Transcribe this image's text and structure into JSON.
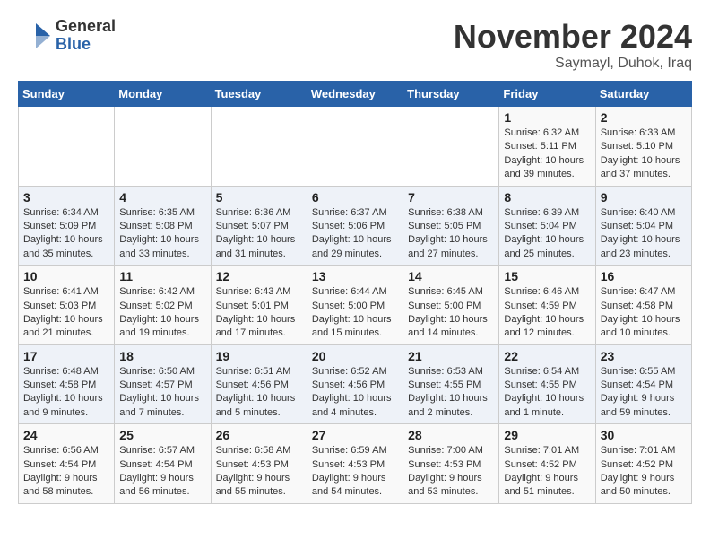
{
  "logo": {
    "general": "General",
    "blue": "Blue"
  },
  "title": "November 2024",
  "subtitle": "Saymayl, Duhok, Iraq",
  "days_of_week": [
    "Sunday",
    "Monday",
    "Tuesday",
    "Wednesday",
    "Thursday",
    "Friday",
    "Saturday"
  ],
  "weeks": [
    [
      {
        "day": "",
        "detail": ""
      },
      {
        "day": "",
        "detail": ""
      },
      {
        "day": "",
        "detail": ""
      },
      {
        "day": "",
        "detail": ""
      },
      {
        "day": "",
        "detail": ""
      },
      {
        "day": "1",
        "detail": "Sunrise: 6:32 AM\nSunset: 5:11 PM\nDaylight: 10 hours\nand 39 minutes."
      },
      {
        "day": "2",
        "detail": "Sunrise: 6:33 AM\nSunset: 5:10 PM\nDaylight: 10 hours\nand 37 minutes."
      }
    ],
    [
      {
        "day": "3",
        "detail": "Sunrise: 6:34 AM\nSunset: 5:09 PM\nDaylight: 10 hours\nand 35 minutes."
      },
      {
        "day": "4",
        "detail": "Sunrise: 6:35 AM\nSunset: 5:08 PM\nDaylight: 10 hours\nand 33 minutes."
      },
      {
        "day": "5",
        "detail": "Sunrise: 6:36 AM\nSunset: 5:07 PM\nDaylight: 10 hours\nand 31 minutes."
      },
      {
        "day": "6",
        "detail": "Sunrise: 6:37 AM\nSunset: 5:06 PM\nDaylight: 10 hours\nand 29 minutes."
      },
      {
        "day": "7",
        "detail": "Sunrise: 6:38 AM\nSunset: 5:05 PM\nDaylight: 10 hours\nand 27 minutes."
      },
      {
        "day": "8",
        "detail": "Sunrise: 6:39 AM\nSunset: 5:04 PM\nDaylight: 10 hours\nand 25 minutes."
      },
      {
        "day": "9",
        "detail": "Sunrise: 6:40 AM\nSunset: 5:04 PM\nDaylight: 10 hours\nand 23 minutes."
      }
    ],
    [
      {
        "day": "10",
        "detail": "Sunrise: 6:41 AM\nSunset: 5:03 PM\nDaylight: 10 hours\nand 21 minutes."
      },
      {
        "day": "11",
        "detail": "Sunrise: 6:42 AM\nSunset: 5:02 PM\nDaylight: 10 hours\nand 19 minutes."
      },
      {
        "day": "12",
        "detail": "Sunrise: 6:43 AM\nSunset: 5:01 PM\nDaylight: 10 hours\nand 17 minutes."
      },
      {
        "day": "13",
        "detail": "Sunrise: 6:44 AM\nSunset: 5:00 PM\nDaylight: 10 hours\nand 15 minutes."
      },
      {
        "day": "14",
        "detail": "Sunrise: 6:45 AM\nSunset: 5:00 PM\nDaylight: 10 hours\nand 14 minutes."
      },
      {
        "day": "15",
        "detail": "Sunrise: 6:46 AM\nSunset: 4:59 PM\nDaylight: 10 hours\nand 12 minutes."
      },
      {
        "day": "16",
        "detail": "Sunrise: 6:47 AM\nSunset: 4:58 PM\nDaylight: 10 hours\nand 10 minutes."
      }
    ],
    [
      {
        "day": "17",
        "detail": "Sunrise: 6:48 AM\nSunset: 4:58 PM\nDaylight: 10 hours\nand 9 minutes."
      },
      {
        "day": "18",
        "detail": "Sunrise: 6:50 AM\nSunset: 4:57 PM\nDaylight: 10 hours\nand 7 minutes."
      },
      {
        "day": "19",
        "detail": "Sunrise: 6:51 AM\nSunset: 4:56 PM\nDaylight: 10 hours\nand 5 minutes."
      },
      {
        "day": "20",
        "detail": "Sunrise: 6:52 AM\nSunset: 4:56 PM\nDaylight: 10 hours\nand 4 minutes."
      },
      {
        "day": "21",
        "detail": "Sunrise: 6:53 AM\nSunset: 4:55 PM\nDaylight: 10 hours\nand 2 minutes."
      },
      {
        "day": "22",
        "detail": "Sunrise: 6:54 AM\nSunset: 4:55 PM\nDaylight: 10 hours\nand 1 minute."
      },
      {
        "day": "23",
        "detail": "Sunrise: 6:55 AM\nSunset: 4:54 PM\nDaylight: 9 hours\nand 59 minutes."
      }
    ],
    [
      {
        "day": "24",
        "detail": "Sunrise: 6:56 AM\nSunset: 4:54 PM\nDaylight: 9 hours\nand 58 minutes."
      },
      {
        "day": "25",
        "detail": "Sunrise: 6:57 AM\nSunset: 4:54 PM\nDaylight: 9 hours\nand 56 minutes."
      },
      {
        "day": "26",
        "detail": "Sunrise: 6:58 AM\nSunset: 4:53 PM\nDaylight: 9 hours\nand 55 minutes."
      },
      {
        "day": "27",
        "detail": "Sunrise: 6:59 AM\nSunset: 4:53 PM\nDaylight: 9 hours\nand 54 minutes."
      },
      {
        "day": "28",
        "detail": "Sunrise: 7:00 AM\nSunset: 4:53 PM\nDaylight: 9 hours\nand 53 minutes."
      },
      {
        "day": "29",
        "detail": "Sunrise: 7:01 AM\nSunset: 4:52 PM\nDaylight: 9 hours\nand 51 minutes."
      },
      {
        "day": "30",
        "detail": "Sunrise: 7:01 AM\nSunset: 4:52 PM\nDaylight: 9 hours\nand 50 minutes."
      }
    ]
  ]
}
